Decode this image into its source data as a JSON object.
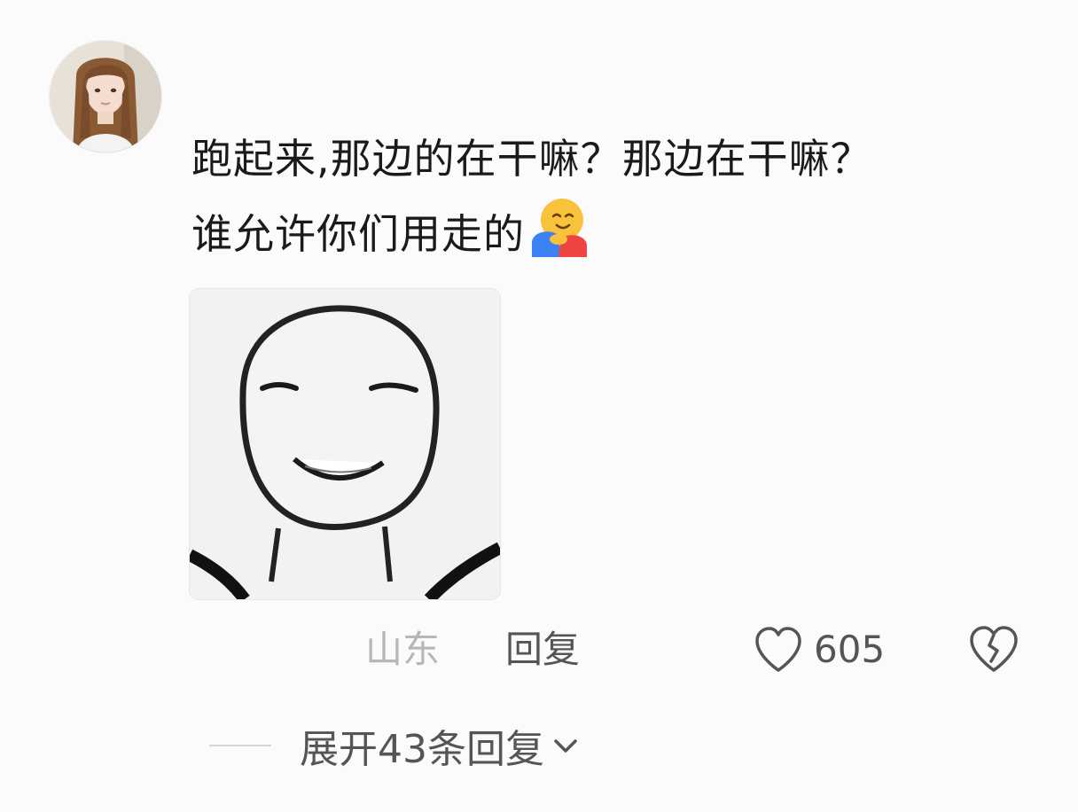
{
  "comment": {
    "lines": [
      "跑起来,那边的在干嘛？那边在干嘛？",
      "谁允许你们用走的"
    ]
  },
  "footer": {
    "location": "山东",
    "reply_label": "回复",
    "like_count": "605"
  },
  "expand": {
    "label": "展开43条回复"
  },
  "icons": {
    "avatar": "user-avatar",
    "emoji": "hugging-face-emoji",
    "like": "heart-outline-icon",
    "dislike": "broken-heart-icon",
    "expand": "chevron-down-icon"
  },
  "colors": {
    "background": "#fbfbfb",
    "text_primary": "#1a1a1a",
    "text_secondary": "#555555",
    "text_muted": "#b7b7b7"
  }
}
